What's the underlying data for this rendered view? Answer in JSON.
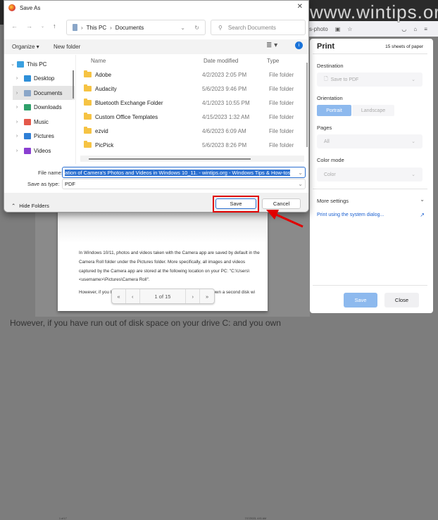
{
  "watermark": "www.wintips.org",
  "browser": {
    "tab_fragment": "s-photo"
  },
  "dialog": {
    "title": "Save As",
    "breadcrumb": [
      "This PC",
      "Documents"
    ],
    "search_placeholder": "Search Documents",
    "toolbar": {
      "organize": "Organize ▾",
      "new_folder": "New folder"
    },
    "sidebar": [
      {
        "label": "This PC",
        "color": "#3aa0e0"
      },
      {
        "label": "Desktop",
        "color": "#2e8fd8"
      },
      {
        "label": "Documents",
        "color": "#8aa6c8"
      },
      {
        "label": "Downloads",
        "color": "#2ea06a"
      },
      {
        "label": "Music",
        "color": "#e4584a"
      },
      {
        "label": "Pictures",
        "color": "#2f7fd6"
      },
      {
        "label": "Videos",
        "color": "#8a3fd1"
      }
    ],
    "columns": {
      "name": "Name",
      "date": "Date modified",
      "type": "Type"
    },
    "files": [
      {
        "name": "Adobe",
        "date": "4/2/2023 2:05 PM",
        "type": "File folder"
      },
      {
        "name": "Audacity",
        "date": "5/6/2023 9:46 PM",
        "type": "File folder"
      },
      {
        "name": "Bluetooth Exchange Folder",
        "date": "4/1/2023 10:55 PM",
        "type": "File folder"
      },
      {
        "name": "Custom Office Templates",
        "date": "4/15/2023 1:32 AM",
        "type": "File folder"
      },
      {
        "name": "ezvid",
        "date": "4/6/2023 6:09 AM",
        "type": "File folder"
      },
      {
        "name": "PicPick",
        "date": "5/6/2023 8:26 PM",
        "type": "File folder"
      }
    ],
    "file_name_label": "File name:",
    "file_name_value": "ation of Camera's Photos and Videos in Windows 10_11. - wintips.org - Windows Tips & How-tos",
    "save_type_label": "Save as type:",
    "save_type_value": "PDF",
    "hide_folders": "Hide Folders",
    "save": "Save",
    "cancel": "Cancel"
  },
  "print": {
    "title": "Print",
    "sheets": "15 sheets of paper",
    "destination_label": "Destination",
    "destination": "Save to PDF",
    "orientation_label": "Orientation",
    "portrait": "Portrait",
    "landscape": "Landscape",
    "pages_label": "Pages",
    "pages": "All",
    "color_label": "Color mode",
    "color": "Color",
    "more_settings": "More settings",
    "system_dialog": "Print using the system dialog...",
    "save": "Save",
    "close": "Close"
  },
  "preview": {
    "para1": "In Windows 10/11, photos and videos taken with the Camera app are saved by default in the Camera Roll folder under the Pictures folder. More specifically, all images and videos captured by the Camera app are stored at the following location on your PC: \"C:\\Users\\<username>\\Pictures\\Camera Roll\".",
    "para2": "However, if you have run out of disk space on your drive C: and you own a second disk wi                                                    e the default",
    "page_indicator": "1 of 15",
    "footer_left": "1 of 17",
    "footer_right": "7/17/2023, 4:01 AM"
  },
  "page_bottom_text": "However, if you have run out of disk space on your drive C: and you own"
}
